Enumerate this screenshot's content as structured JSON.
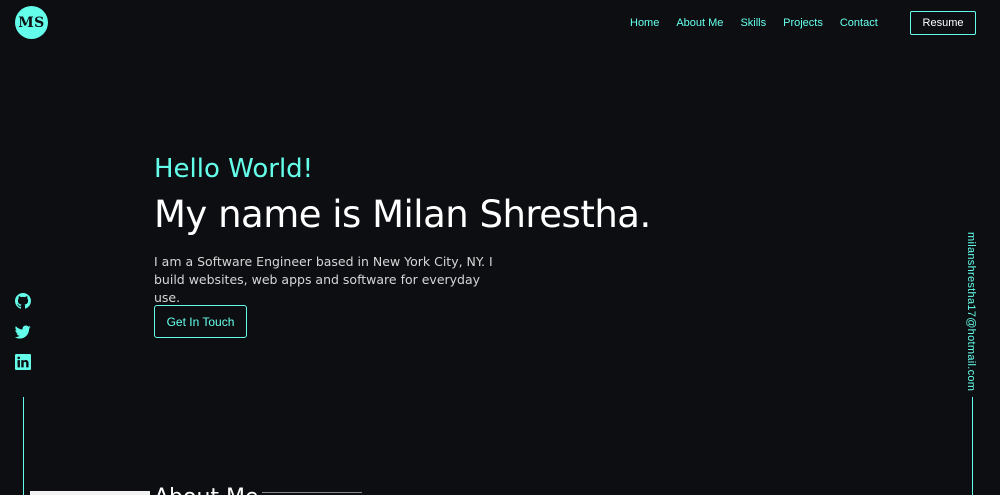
{
  "brand": {
    "logo_text": "MS"
  },
  "nav": {
    "items": [
      {
        "label": "Home"
      },
      {
        "label": "About Me"
      },
      {
        "label": "Skills"
      },
      {
        "label": "Projects"
      },
      {
        "label": "Contact"
      }
    ],
    "resume_label": "Resume"
  },
  "hero": {
    "greeting": "Hello World!",
    "headline": "My name is Milan Shrestha.",
    "intro_line1": "I am a Software Engineer based in New York City, NY. I",
    "intro_line2": "build websites, web apps and software for everyday use.",
    "cta_label": "Get In Touch"
  },
  "social": {
    "icons": [
      "github-icon",
      "twitter-icon",
      "linkedin-icon"
    ]
  },
  "contact": {
    "email": "milanshrestha17@hotmail.com"
  },
  "next_section": {
    "title_peek": "About Me"
  },
  "colors": {
    "accent": "#64ffea",
    "background": "#0d0e12",
    "text": "#ffffff"
  }
}
